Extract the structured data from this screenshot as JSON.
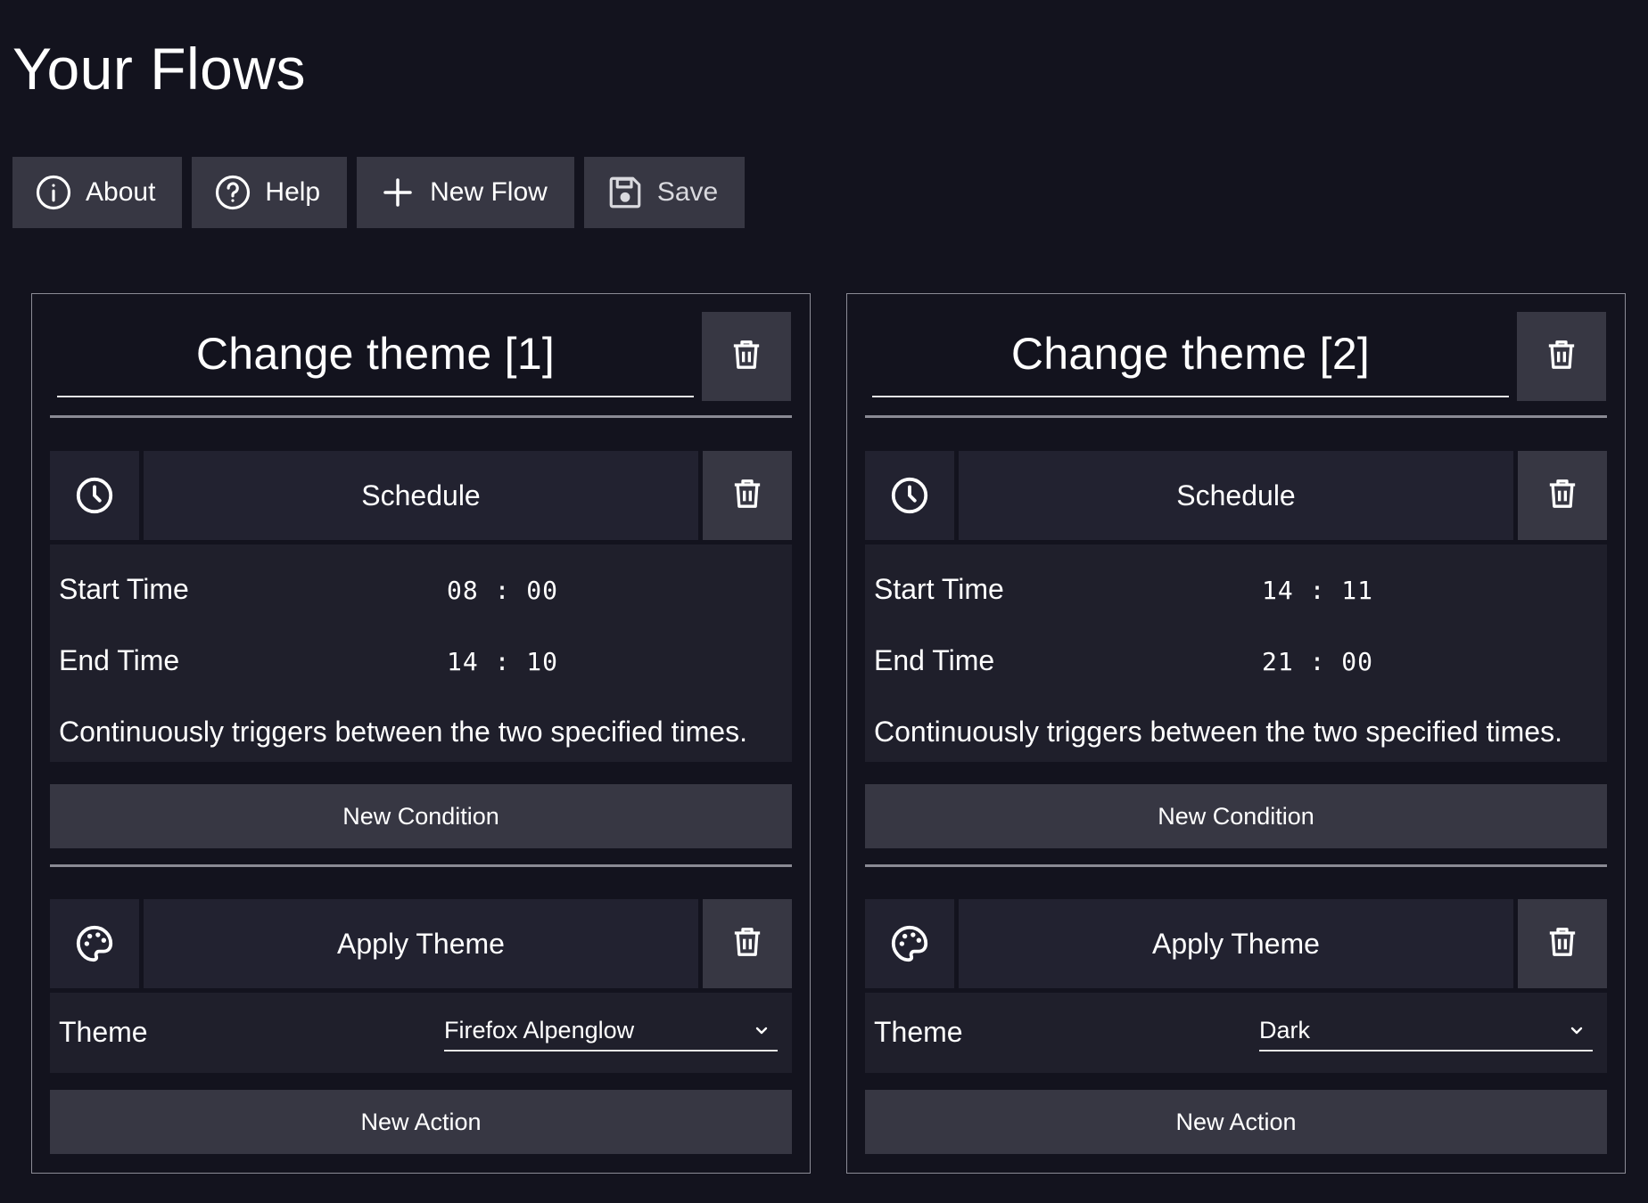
{
  "page": {
    "title": "Your Flows"
  },
  "toolbar": {
    "about_label": "About",
    "help_label": "Help",
    "new_flow_label": "New Flow",
    "save_label": "Save"
  },
  "icons": {
    "about": "info-circle-icon",
    "help": "question-circle-icon",
    "new_flow": "plus-icon",
    "save": "floppy-disk-icon",
    "delete": "trash-icon",
    "schedule": "clock-icon",
    "theme": "palette-icon",
    "dropdown": "chevron-down-icon"
  },
  "colors": {
    "background": "#13131e",
    "button": "#373743",
    "panel": "#222230",
    "body": "#1f1f2b",
    "text": "#ffffff"
  },
  "flows": [
    {
      "title": "Change theme [1]",
      "condition": {
        "title": "Schedule",
        "start_label": "Start Time",
        "start_value": "08 : 00",
        "end_label": "End Time",
        "end_value": "14 : 10",
        "description": "Continuously triggers between the two specified times."
      },
      "new_condition_label": "New Condition",
      "action": {
        "title": "Apply Theme",
        "theme_label": "Theme",
        "theme_value": "Firefox Alpenglow"
      },
      "new_action_label": "New Action"
    },
    {
      "title": "Change theme [2]",
      "condition": {
        "title": "Schedule",
        "start_label": "Start Time",
        "start_value": "14 : 11",
        "end_label": "End Time",
        "end_value": "21 : 00",
        "description": "Continuously triggers between the two specified times."
      },
      "new_condition_label": "New Condition",
      "action": {
        "title": "Apply Theme",
        "theme_label": "Theme",
        "theme_value": "Dark"
      },
      "new_action_label": "New Action"
    }
  ]
}
